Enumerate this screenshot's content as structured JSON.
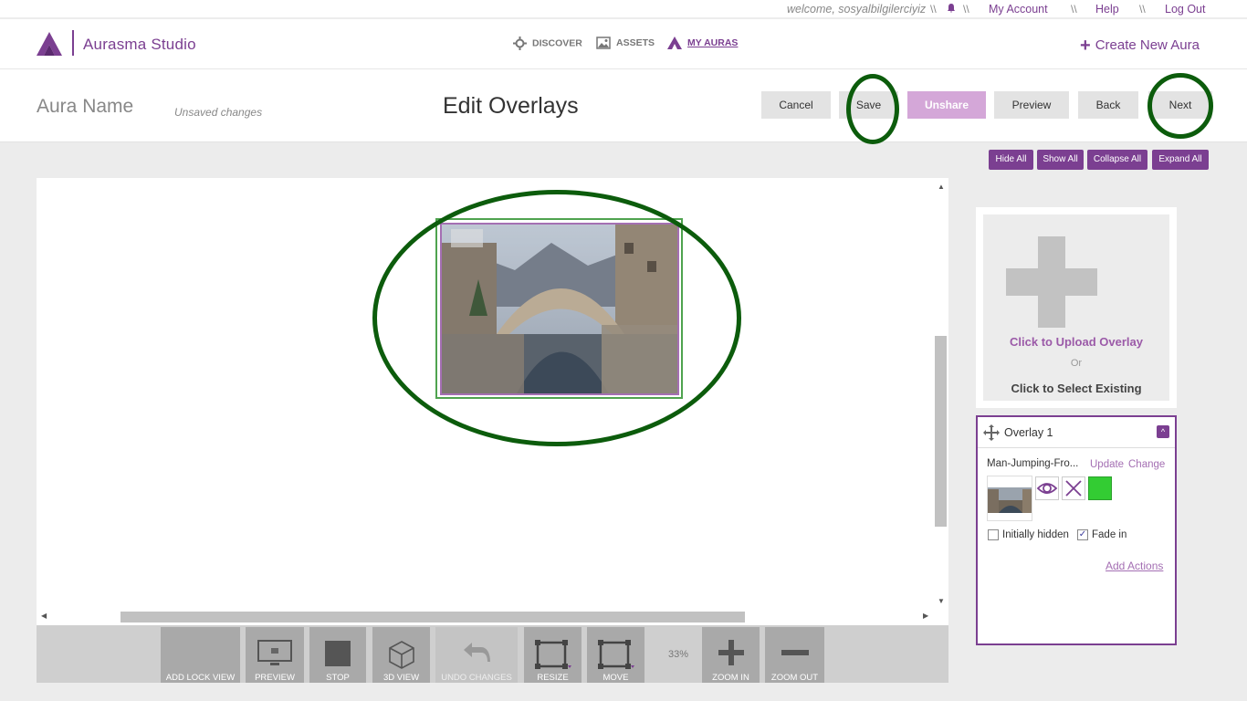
{
  "util": {
    "welcome": "welcome, sosyalbilgilerciyiz",
    "separator": "\\\\",
    "my_account": "My Account",
    "help": "Help",
    "logout": "Log Out"
  },
  "header": {
    "brand": "Aurasma Studio",
    "nav": {
      "discover": "DISCOVER",
      "assets": "ASSETS",
      "my_auras": "MY AURAS"
    },
    "create": "Create New Aura",
    "create_icon": "+"
  },
  "titlebar": {
    "aura_name": "Aura Name",
    "unsaved": "Unsaved changes",
    "title": "Edit Overlays",
    "buttons": {
      "cancel": "Cancel",
      "save": "Save",
      "unshare": "Unshare",
      "preview": "Preview",
      "back": "Back",
      "next": "Next"
    }
  },
  "panel_buttons": {
    "hide_all": "Hide All",
    "show_all": "Show All",
    "collapse_all": "Collapse All",
    "expand_all": "Expand All"
  },
  "toolbar": {
    "add_lock_view": "ADD LOCK VIEW",
    "preview": "PREVIEW",
    "stop": "STOP",
    "view_3d": "3D VIEW",
    "undo": "UNDO CHANGES",
    "resize": "RESIZE",
    "move": "MOVE",
    "zoom_level": "33%",
    "zoom_in": "ZOOM IN",
    "zoom_out": "ZOOM OUT"
  },
  "upload": {
    "upload": "Click to Upload Overlay",
    "or": "Or",
    "select": "Click to Select Existing"
  },
  "overlay": {
    "title": "Overlay 1",
    "collapse_glyph": "^",
    "filename": "Man-Jumping-Fro...",
    "update": "Update",
    "change": "Change",
    "initially_hidden": "Initially hidden",
    "fade_in": "Fade in",
    "fade_in_check": "✓",
    "add_actions": "Add Actions",
    "initially_hidden_checked": false,
    "fade_in_checked": true
  },
  "colors": {
    "brand": "#7b3f91",
    "annotation": "#0c5c0c",
    "overlay_green": "#33cc33"
  },
  "icons": [
    "aurasma-logo-icon",
    "bell-icon",
    "discover-icon",
    "assets-icon",
    "my-auras-icon",
    "plus-icon",
    "move-icon",
    "eye-icon",
    "close-icon",
    "color-swatch-icon",
    "chevron-up-icon"
  ]
}
